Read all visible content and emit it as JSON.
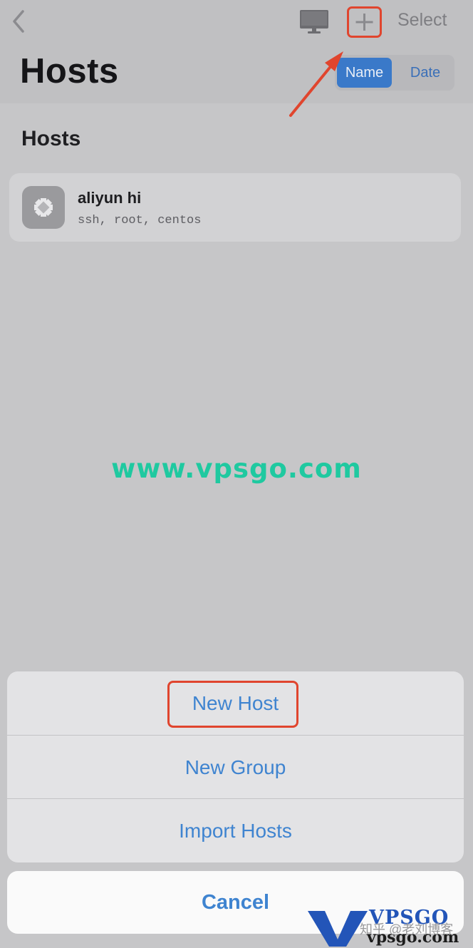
{
  "nav": {
    "title": "Hosts",
    "select_label": "Select",
    "sort": {
      "options": [
        "Name",
        "Date"
      ],
      "selected": "Name"
    }
  },
  "section": {
    "title": "Hosts"
  },
  "hosts": [
    {
      "name": "aliyun hi",
      "details": "ssh, root, centos",
      "icon": "centos-icon"
    }
  ],
  "watermark": "www.vpsgo.com",
  "action_sheet": {
    "items": [
      "New Host",
      "New Group",
      "Import Hosts"
    ],
    "cancel_label": "Cancel"
  },
  "logo": {
    "top": "VPSGO",
    "bottom": "vpsgo.com"
  },
  "zhihu_mark": "知乎 @老刘博客",
  "colors": {
    "accent": "#3f84d0",
    "highlight": "#e0452e",
    "watermark": "#1fc9a0"
  }
}
